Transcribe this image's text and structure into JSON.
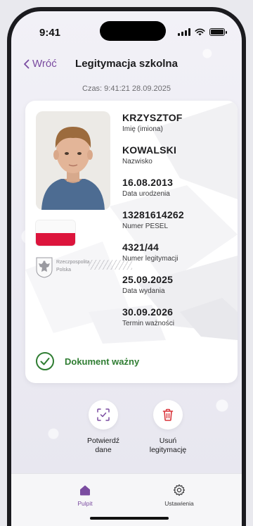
{
  "status_bar": {
    "time": "9:41"
  },
  "nav": {
    "back_label": "Wróć",
    "title": "Legitymacja szkolna"
  },
  "timestamp": "Czas: 9:41:21 28.09.2025",
  "card": {
    "emblem_text_line1": "Rzeczpospolita",
    "emblem_text_line2": "Polska",
    "fields": [
      {
        "value": "KRZYSZTOF",
        "label": "Imię (imiona)"
      },
      {
        "value": "KOWALSKI",
        "label": "Nazwisko"
      },
      {
        "value": "16.08.2013",
        "label": "Data urodzenia"
      },
      {
        "value": "13281614262",
        "label": "Numer PESEL"
      },
      {
        "value": "4321/44",
        "label": "Numer legitymacji"
      },
      {
        "value": "25.09.2025",
        "label": "Data wydania"
      },
      {
        "value": "30.09.2026",
        "label": "Termin ważności"
      }
    ],
    "validity": "Dokument ważny"
  },
  "actions": {
    "confirm_line1": "Potwierdź",
    "confirm_line2": "dane",
    "delete_line1": "Usuń",
    "delete_line2": "legitymację"
  },
  "tabbar": {
    "tabs": [
      {
        "label": "Pulpit",
        "icon": "home-icon",
        "active": true
      },
      {
        "label": "Ustawienia",
        "icon": "gear-icon",
        "active": false
      }
    ]
  },
  "colors": {
    "accent": "#7a4ba0",
    "valid_green": "#2f7d32",
    "danger_red": "#d9343a",
    "flag_red": "#dc143c"
  }
}
